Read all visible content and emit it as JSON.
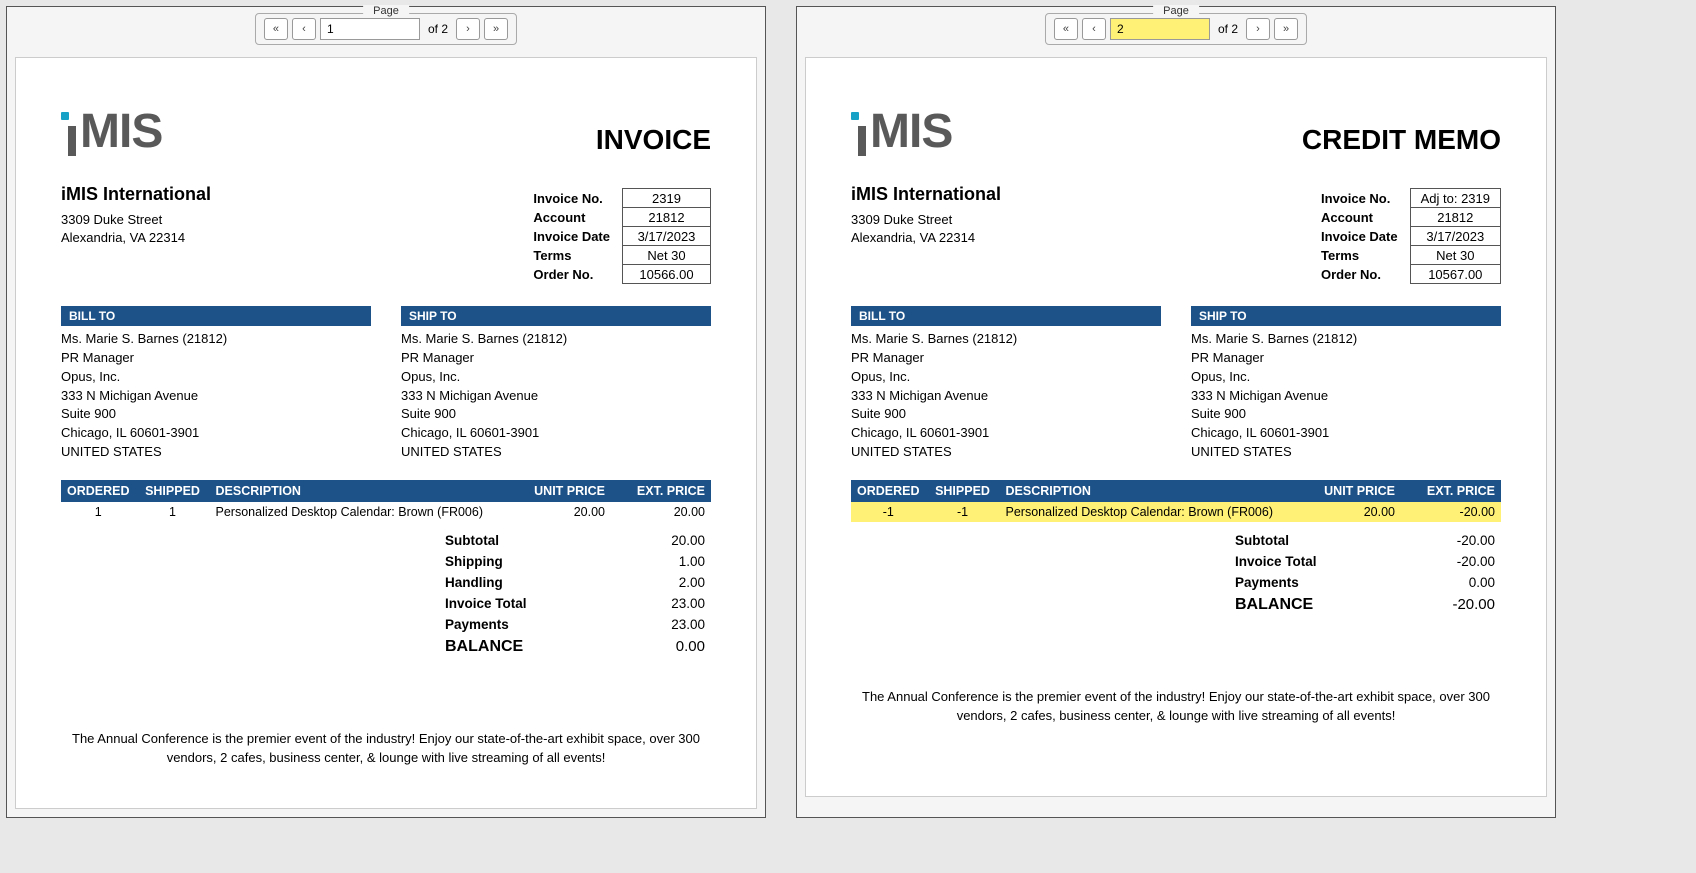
{
  "panels": [
    {
      "pager": {
        "legend": "Page",
        "value": "1",
        "of_label": "of 2",
        "highlight": false
      },
      "doc_title": "INVOICE",
      "company": {
        "name": "iMIS International",
        "addr1": "3309 Duke Street",
        "addr2": "Alexandria, VA 22314"
      },
      "meta": [
        {
          "label": "Invoice No.",
          "value": "2319"
        },
        {
          "label": "Account",
          "value": "21812"
        },
        {
          "label": "Invoice Date",
          "value": "3/17/2023"
        },
        {
          "label": "Terms",
          "value": "Net 30"
        },
        {
          "label": "Order No.",
          "value": "10566.00"
        }
      ],
      "bill_to": {
        "heading": "BILL TO",
        "lines": [
          "Ms. Marie S. Barnes (21812)",
          "PR Manager",
          "Opus, Inc.",
          "333 N Michigan Avenue",
          "Suite 900",
          "Chicago, IL 60601-3901",
          "UNITED STATES"
        ]
      },
      "ship_to": {
        "heading": "SHIP TO",
        "lines": [
          "Ms. Marie S. Barnes (21812)",
          "PR Manager",
          "Opus, Inc.",
          "333 N Michigan Avenue",
          "Suite 900",
          "Chicago, IL 60601-3901",
          "UNITED STATES"
        ]
      },
      "items_header": {
        "ordered": "ORDERED",
        "shipped": "SHIPPED",
        "description": "DESCRIPTION",
        "unit_price": "UNIT PRICE",
        "ext_price": "EXT. PRICE"
      },
      "items": [
        {
          "ordered": "1",
          "shipped": "1",
          "description": "Personalized Desktop Calendar: Brown (FR006)",
          "unit_price": "20.00",
          "ext_price": "20.00",
          "highlight": false
        }
      ],
      "totals": [
        {
          "label": "Subtotal",
          "value": "20.00",
          "balance": false
        },
        {
          "label": "Shipping",
          "value": "1.00",
          "balance": false
        },
        {
          "label": "Handling",
          "value": "2.00",
          "balance": false
        },
        {
          "label": "Invoice Total",
          "value": "23.00",
          "balance": false
        },
        {
          "label": "Payments",
          "value": "23.00",
          "balance": false
        },
        {
          "label": "BALANCE",
          "value": "0.00",
          "balance": true
        }
      ],
      "footer": "The Annual Conference is the premier event of the industry!  Enjoy our state-of-the-art exhibit space, over 300 vendors, 2 cafes, business center, & lounge with live streaming of all events!"
    },
    {
      "pager": {
        "legend": "Page",
        "value": "2",
        "of_label": "of 2",
        "highlight": true
      },
      "doc_title": "CREDIT MEMO",
      "company": {
        "name": "iMIS International",
        "addr1": "3309 Duke Street",
        "addr2": "Alexandria, VA 22314"
      },
      "meta": [
        {
          "label": "Invoice No.",
          "value": "Adj to: 2319"
        },
        {
          "label": "Account",
          "value": "21812"
        },
        {
          "label": "Invoice Date",
          "value": "3/17/2023"
        },
        {
          "label": "Terms",
          "value": "Net 30"
        },
        {
          "label": "Order No.",
          "value": "10567.00"
        }
      ],
      "bill_to": {
        "heading": "BILL TO",
        "lines": [
          "Ms. Marie S. Barnes (21812)",
          "PR Manager",
          "Opus, Inc.",
          "333 N Michigan Avenue",
          "Suite 900",
          "Chicago, IL 60601-3901",
          "UNITED STATES"
        ]
      },
      "ship_to": {
        "heading": "SHIP TO",
        "lines": [
          "Ms. Marie S. Barnes (21812)",
          "PR Manager",
          "Opus, Inc.",
          "333 N Michigan Avenue",
          "Suite 900",
          "Chicago, IL 60601-3901",
          "UNITED STATES"
        ]
      },
      "items_header": {
        "ordered": "ORDERED",
        "shipped": "SHIPPED",
        "description": "DESCRIPTION",
        "unit_price": "UNIT PRICE",
        "ext_price": "EXT. PRICE"
      },
      "items": [
        {
          "ordered": "-1",
          "shipped": "-1",
          "description": "Personalized Desktop Calendar: Brown (FR006)",
          "unit_price": "20.00",
          "ext_price": "-20.00",
          "highlight": true
        }
      ],
      "totals": [
        {
          "label": "Subtotal",
          "value": "-20.00",
          "balance": false
        },
        {
          "label": "Invoice Total",
          "value": "-20.00",
          "balance": false
        },
        {
          "label": "Payments",
          "value": "0.00",
          "balance": false
        },
        {
          "label": "BALANCE",
          "value": "-20.00",
          "balance": true
        }
      ],
      "footer": "The Annual Conference is the premier event of the industry!  Enjoy our state-of-the-art exhibit space, over 300 vendors, 2 cafes, business center, & lounge with live streaming of all events!"
    }
  ]
}
